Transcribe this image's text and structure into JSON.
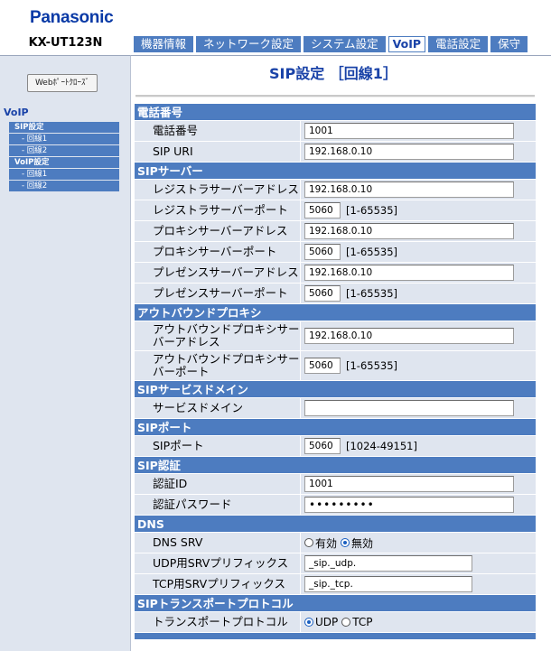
{
  "brand": "Panasonic",
  "model": "KX-UT123N",
  "tabs": [
    {
      "label": "機器情報",
      "active": false
    },
    {
      "label": "ネットワーク設定",
      "active": false
    },
    {
      "label": "システム設定",
      "active": false
    },
    {
      "label": "VoIP",
      "active": true
    },
    {
      "label": "電話設定",
      "active": false
    },
    {
      "label": "保守",
      "active": false
    }
  ],
  "sidebar": {
    "close_button": "Webﾎﾟｰﾄｸﾛｰｽﾞ",
    "heading": "VoIP",
    "items": [
      {
        "label": "SIP設定",
        "type": "group"
      },
      {
        "label": "- 回線1",
        "type": "sub"
      },
      {
        "label": "- 回線2",
        "type": "sub"
      },
      {
        "label": "VoIP設定",
        "type": "group"
      },
      {
        "label": "- 回線1",
        "type": "sub"
      },
      {
        "label": "- 回線2",
        "type": "sub"
      }
    ]
  },
  "page_title": "SIP設定 ［回線1］",
  "sections": {
    "phone": {
      "title": "電話番号",
      "phone_number": {
        "label": "電話番号",
        "value": "1001"
      },
      "sip_uri": {
        "label": "SIP URI",
        "value": "192.168.0.10"
      }
    },
    "sip_server": {
      "title": "SIPサーバー",
      "registrar_addr": {
        "label": "レジストラサーバーアドレス",
        "value": "192.168.0.10"
      },
      "registrar_port": {
        "label": "レジストラサーバーポート",
        "value": "5060",
        "range": "[1-65535]"
      },
      "proxy_addr": {
        "label": "プロキシサーバーアドレス",
        "value": "192.168.0.10"
      },
      "proxy_port": {
        "label": "プロキシサーバーポート",
        "value": "5060",
        "range": "[1-65535]"
      },
      "presence_addr": {
        "label": "プレゼンスサーバーアドレス",
        "value": "192.168.0.10"
      },
      "presence_port": {
        "label": "プレゼンスサーバーポート",
        "value": "5060",
        "range": "[1-65535]"
      }
    },
    "outbound": {
      "title": "アウトバウンドプロキシ",
      "addr": {
        "label": "アウトバウンドプロキシサーバーアドレス",
        "value": "192.168.0.10"
      },
      "port": {
        "label": "アウトバウンドプロキシサーバーポート",
        "value": "5060",
        "range": "[1-65535]"
      }
    },
    "service_domain": {
      "title": "SIPサービスドメイン",
      "domain": {
        "label": "サービスドメイン",
        "value": ""
      }
    },
    "sip_port": {
      "title": "SIPポート",
      "port": {
        "label": "SIPポート",
        "value": "5060",
        "range": "[1024-49151]"
      }
    },
    "auth": {
      "title": "SIP認証",
      "auth_id": {
        "label": "認証ID",
        "value": "1001"
      },
      "password": {
        "label": "認証パスワード",
        "value": "•••••••••"
      }
    },
    "dns": {
      "title": "DNS",
      "dns_srv": {
        "label": "DNS SRV",
        "opt_on": "有効",
        "opt_off": "無効",
        "selected": "無効"
      },
      "udp_prefix": {
        "label": "UDP用SRVプリフィックス",
        "value": "_sip._udp."
      },
      "tcp_prefix": {
        "label": "TCP用SRVプリフィックス",
        "value": "_sip._tcp."
      }
    },
    "transport": {
      "title": "SIPトランスポートプロトコル",
      "protocol": {
        "label": "トランスポートプロトコル",
        "opt_udp": "UDP",
        "opt_tcp": "TCP",
        "selected": "UDP"
      }
    }
  },
  "colors": {
    "accent": "#4d7cc0",
    "brand": "#0a3aa6",
    "row_bg": "#dfe5ef"
  }
}
